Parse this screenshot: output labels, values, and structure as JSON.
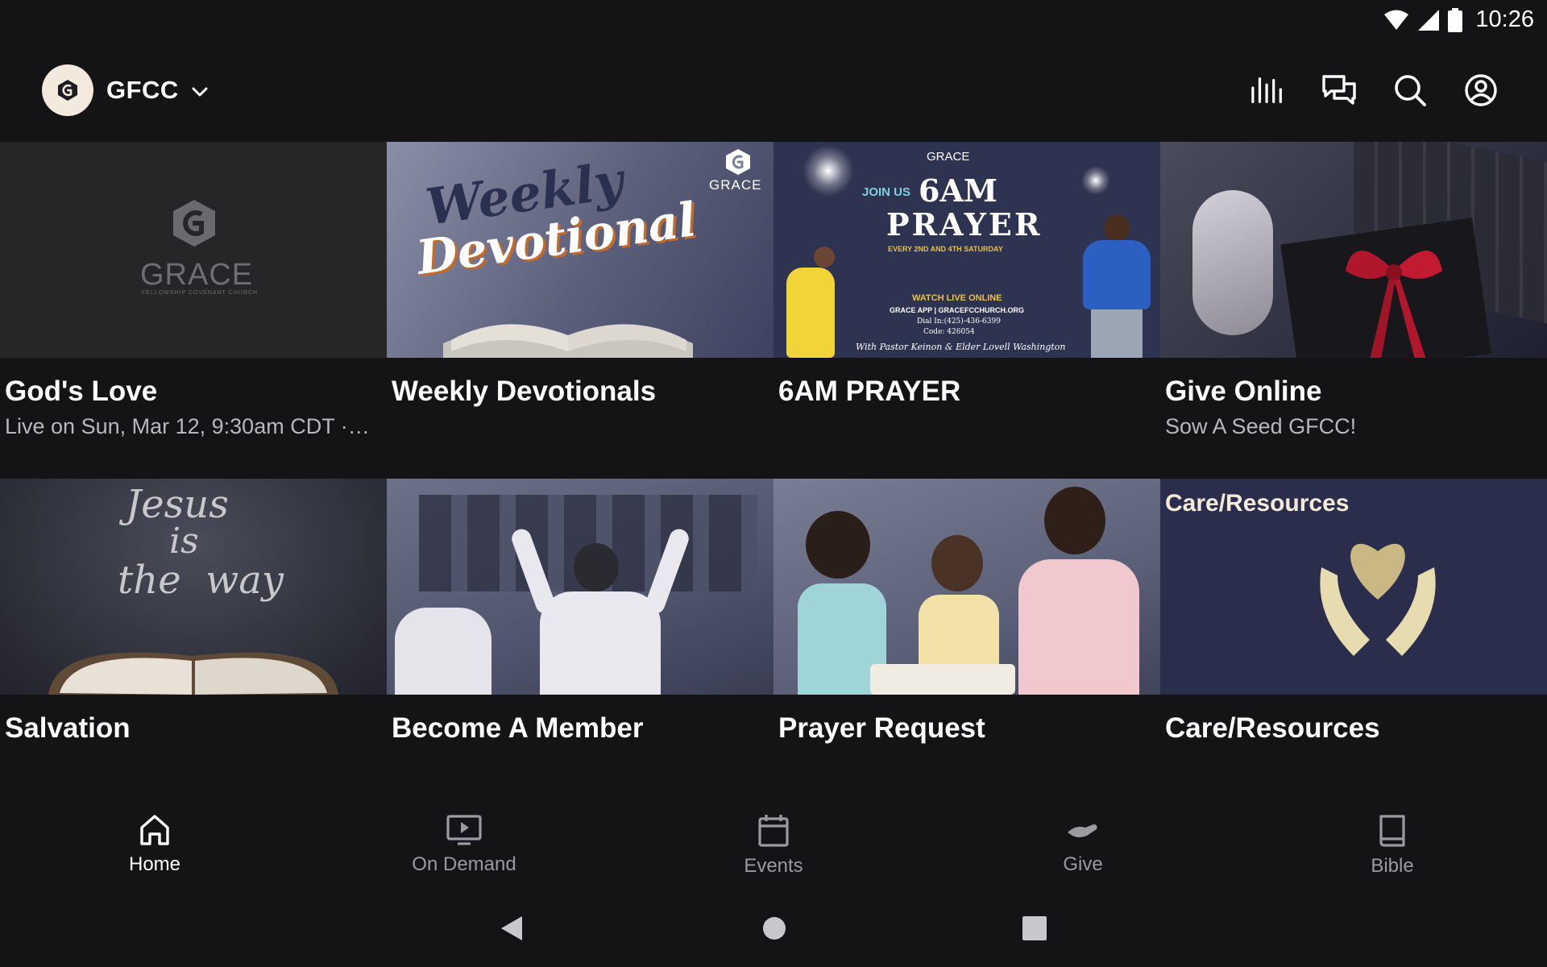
{
  "status": {
    "time": "10:26"
  },
  "header": {
    "org_name": "GFCC",
    "actions": [
      "bars-icon",
      "chat-icon",
      "search-icon",
      "account-icon"
    ]
  },
  "cards": [
    {
      "title": "God's Love",
      "subtitle": "Live on Sun, Mar 12, 9:30am CDT ·…",
      "thumb_text": "GRACE",
      "thumb_small": "FELLOWSHIP COVENANT CHURCH"
    },
    {
      "title": "Weekly Devotionals",
      "subtitle": "",
      "thumb_text": "Weekly",
      "thumb_text2": "Devotional",
      "thumb_brand": "GRACE"
    },
    {
      "title": "6AM PRAYER",
      "subtitle": "",
      "thumb": {
        "brand": "GRACE",
        "join": "JOIN US",
        "big1": "6AM",
        "big2": "PRAYER",
        "sched": "EVERY 2ND AND 4TH SATURDAY",
        "watch": "WATCH LIVE ONLINE",
        "app": "GRACE APP | GRACEFCCHURCH.ORG",
        "dial": "Dial In:(425)-436-6399",
        "code": "Code: 426054",
        "with": "With Pastor Keinon & Elder Lovell Washington"
      }
    },
    {
      "title": "Give Online",
      "subtitle": "Sow A Seed GFCC!"
    },
    {
      "title": "Salvation",
      "subtitle": "",
      "thumb_lines": [
        "Jesus",
        "is",
        "the  way"
      ]
    },
    {
      "title": "Become A Member",
      "subtitle": ""
    },
    {
      "title": "Prayer Request",
      "subtitle": ""
    },
    {
      "title": "Care/Resources",
      "subtitle": "",
      "thumb_text": "Care/Resources"
    }
  ],
  "nav": [
    {
      "label": "Home",
      "icon": "home-icon",
      "active": true
    },
    {
      "label": "On Demand",
      "icon": "tv-play-icon"
    },
    {
      "label": "Events",
      "icon": "calendar-icon"
    },
    {
      "label": "Give",
      "icon": "hand-give-icon"
    },
    {
      "label": "Bible",
      "icon": "book-icon"
    }
  ],
  "colors": {
    "background": "#141416",
    "text": "#ffffff",
    "muted": "#9a9aa0",
    "logo_bg": "#f3e9dc"
  }
}
